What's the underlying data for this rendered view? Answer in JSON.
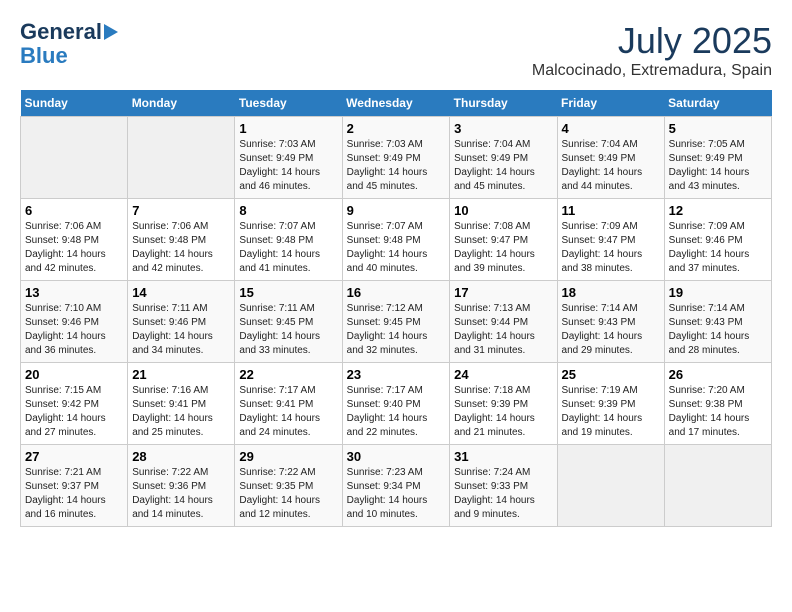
{
  "header": {
    "logo_line1": "General",
    "logo_line2": "Blue",
    "month": "July 2025",
    "location": "Malcocinado, Extremadura, Spain"
  },
  "weekdays": [
    "Sunday",
    "Monday",
    "Tuesday",
    "Wednesday",
    "Thursday",
    "Friday",
    "Saturday"
  ],
  "weeks": [
    [
      {
        "day": "",
        "info": ""
      },
      {
        "day": "",
        "info": ""
      },
      {
        "day": "1",
        "info": "Sunrise: 7:03 AM\nSunset: 9:49 PM\nDaylight: 14 hours\nand 46 minutes."
      },
      {
        "day": "2",
        "info": "Sunrise: 7:03 AM\nSunset: 9:49 PM\nDaylight: 14 hours\nand 45 minutes."
      },
      {
        "day": "3",
        "info": "Sunrise: 7:04 AM\nSunset: 9:49 PM\nDaylight: 14 hours\nand 45 minutes."
      },
      {
        "day": "4",
        "info": "Sunrise: 7:04 AM\nSunset: 9:49 PM\nDaylight: 14 hours\nand 44 minutes."
      },
      {
        "day": "5",
        "info": "Sunrise: 7:05 AM\nSunset: 9:49 PM\nDaylight: 14 hours\nand 43 minutes."
      }
    ],
    [
      {
        "day": "6",
        "info": "Sunrise: 7:06 AM\nSunset: 9:48 PM\nDaylight: 14 hours\nand 42 minutes."
      },
      {
        "day": "7",
        "info": "Sunrise: 7:06 AM\nSunset: 9:48 PM\nDaylight: 14 hours\nand 42 minutes."
      },
      {
        "day": "8",
        "info": "Sunrise: 7:07 AM\nSunset: 9:48 PM\nDaylight: 14 hours\nand 41 minutes."
      },
      {
        "day": "9",
        "info": "Sunrise: 7:07 AM\nSunset: 9:48 PM\nDaylight: 14 hours\nand 40 minutes."
      },
      {
        "day": "10",
        "info": "Sunrise: 7:08 AM\nSunset: 9:47 PM\nDaylight: 14 hours\nand 39 minutes."
      },
      {
        "day": "11",
        "info": "Sunrise: 7:09 AM\nSunset: 9:47 PM\nDaylight: 14 hours\nand 38 minutes."
      },
      {
        "day": "12",
        "info": "Sunrise: 7:09 AM\nSunset: 9:46 PM\nDaylight: 14 hours\nand 37 minutes."
      }
    ],
    [
      {
        "day": "13",
        "info": "Sunrise: 7:10 AM\nSunset: 9:46 PM\nDaylight: 14 hours\nand 36 minutes."
      },
      {
        "day": "14",
        "info": "Sunrise: 7:11 AM\nSunset: 9:46 PM\nDaylight: 14 hours\nand 34 minutes."
      },
      {
        "day": "15",
        "info": "Sunrise: 7:11 AM\nSunset: 9:45 PM\nDaylight: 14 hours\nand 33 minutes."
      },
      {
        "day": "16",
        "info": "Sunrise: 7:12 AM\nSunset: 9:45 PM\nDaylight: 14 hours\nand 32 minutes."
      },
      {
        "day": "17",
        "info": "Sunrise: 7:13 AM\nSunset: 9:44 PM\nDaylight: 14 hours\nand 31 minutes."
      },
      {
        "day": "18",
        "info": "Sunrise: 7:14 AM\nSunset: 9:43 PM\nDaylight: 14 hours\nand 29 minutes."
      },
      {
        "day": "19",
        "info": "Sunrise: 7:14 AM\nSunset: 9:43 PM\nDaylight: 14 hours\nand 28 minutes."
      }
    ],
    [
      {
        "day": "20",
        "info": "Sunrise: 7:15 AM\nSunset: 9:42 PM\nDaylight: 14 hours\nand 27 minutes."
      },
      {
        "day": "21",
        "info": "Sunrise: 7:16 AM\nSunset: 9:41 PM\nDaylight: 14 hours\nand 25 minutes."
      },
      {
        "day": "22",
        "info": "Sunrise: 7:17 AM\nSunset: 9:41 PM\nDaylight: 14 hours\nand 24 minutes."
      },
      {
        "day": "23",
        "info": "Sunrise: 7:17 AM\nSunset: 9:40 PM\nDaylight: 14 hours\nand 22 minutes."
      },
      {
        "day": "24",
        "info": "Sunrise: 7:18 AM\nSunset: 9:39 PM\nDaylight: 14 hours\nand 21 minutes."
      },
      {
        "day": "25",
        "info": "Sunrise: 7:19 AM\nSunset: 9:39 PM\nDaylight: 14 hours\nand 19 minutes."
      },
      {
        "day": "26",
        "info": "Sunrise: 7:20 AM\nSunset: 9:38 PM\nDaylight: 14 hours\nand 17 minutes."
      }
    ],
    [
      {
        "day": "27",
        "info": "Sunrise: 7:21 AM\nSunset: 9:37 PM\nDaylight: 14 hours\nand 16 minutes."
      },
      {
        "day": "28",
        "info": "Sunrise: 7:22 AM\nSunset: 9:36 PM\nDaylight: 14 hours\nand 14 minutes."
      },
      {
        "day": "29",
        "info": "Sunrise: 7:22 AM\nSunset: 9:35 PM\nDaylight: 14 hours\nand 12 minutes."
      },
      {
        "day": "30",
        "info": "Sunrise: 7:23 AM\nSunset: 9:34 PM\nDaylight: 14 hours\nand 10 minutes."
      },
      {
        "day": "31",
        "info": "Sunrise: 7:24 AM\nSunset: 9:33 PM\nDaylight: 14 hours\nand 9 minutes."
      },
      {
        "day": "",
        "info": ""
      },
      {
        "day": "",
        "info": ""
      }
    ]
  ]
}
